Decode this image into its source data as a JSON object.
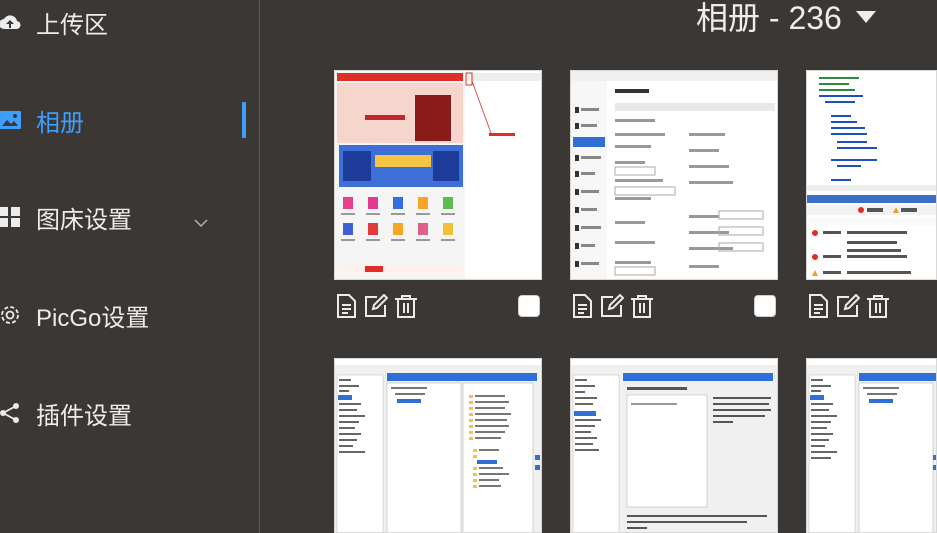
{
  "sidebar": {
    "items": [
      {
        "label": "上传区",
        "icon": "cloud-upload-icon"
      },
      {
        "label": "相册",
        "icon": "image-icon",
        "active": true
      },
      {
        "label": "图床设置",
        "icon": "grid-icon"
      },
      {
        "label": "PicGo设置",
        "icon": "gear-icon"
      },
      {
        "label": "插件设置",
        "icon": "share-icon"
      }
    ]
  },
  "album": {
    "title": "相册 - 236"
  },
  "gallery": {
    "items": [
      {
        "description": "screenshot-shopping-page",
        "selected": false
      },
      {
        "description": "screenshot-text-editor-settings",
        "selected": false
      },
      {
        "description": "screenshot-ide-error-list",
        "selected": false
      },
      {
        "description": "screenshot-vs-options-dialog",
        "selected": false
      },
      {
        "description": "screenshot-vs-options-dialog-2",
        "selected": false
      },
      {
        "description": "screenshot-vs-options-dialog-3",
        "selected": false
      }
    ]
  },
  "colors": {
    "background": "#3a3734",
    "accent": "#409eff",
    "text": "#ececec"
  }
}
